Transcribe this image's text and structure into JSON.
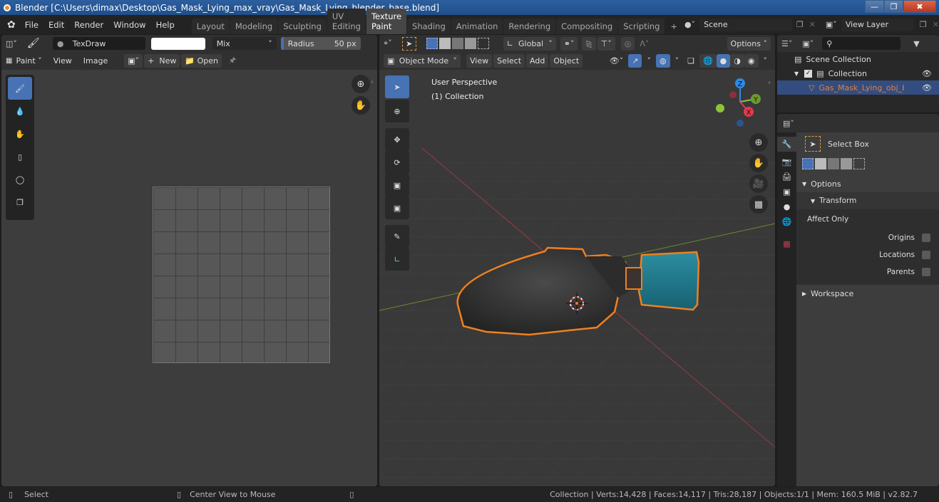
{
  "window": {
    "title": "Blender [C:\\Users\\dimax\\Desktop\\Gas_Mask_Lying_max_vray\\Gas_Mask_Lying_blender_base.blend]",
    "controls": [
      "minimize",
      "maximize",
      "close"
    ]
  },
  "menubar": {
    "items": [
      "File",
      "Edit",
      "Render",
      "Window",
      "Help"
    ],
    "workspace_tabs": [
      "Layout",
      "Modeling",
      "Sculpting",
      "UV Editing",
      "Texture Paint",
      "Shading",
      "Animation",
      "Rendering",
      "Compositing",
      "Scripting"
    ],
    "active_tab": "Texture Paint",
    "add_tab": "+",
    "scene": "Scene",
    "view_layer": "View Layer"
  },
  "image_editor": {
    "brush_name": "TexDraw",
    "color": "#ffffff",
    "blend_mode": "Mix",
    "radius_label": "Radius",
    "radius_value": "50 px",
    "mode_label": "Paint",
    "menus": [
      "View",
      "Image"
    ],
    "new_label": "New",
    "open_label": "Open",
    "tools": [
      "draw-brush",
      "soften-brush",
      "smear-brush",
      "clone-brush",
      "fill-brush",
      "mask-brush"
    ]
  },
  "viewport": {
    "transform_orientation": "Global",
    "options_label": "Options",
    "mode": "Object Mode",
    "menus": [
      "View",
      "Select",
      "Add",
      "Object"
    ],
    "overlay_text_1": "User Perspective",
    "overlay_text_2": "(1) Collection",
    "gizmo_axes": [
      "X",
      "Y",
      "Z"
    ],
    "tools": [
      "select-box",
      "cursor",
      "move",
      "rotate",
      "scale",
      "transform",
      "annotate",
      "measure"
    ],
    "nav_buttons": [
      "zoom",
      "pan",
      "camera",
      "perspective-toggle"
    ]
  },
  "outliner": {
    "search_placeholder": "",
    "items": [
      {
        "label": "Scene Collection",
        "level": 0
      },
      {
        "label": "Collection",
        "level": 1,
        "checked": true
      },
      {
        "label": "Gas_Mask_Lying_obj_bas",
        "level": 2,
        "selected": true
      }
    ]
  },
  "properties": {
    "tool_name": "Select Box",
    "options_label": "Options",
    "transform_label": "Transform",
    "affect_only_label": "Affect Only",
    "checkboxes": [
      {
        "label": "Origins",
        "checked": false
      },
      {
        "label": "Locations",
        "checked": false
      },
      {
        "label": "Parents",
        "checked": false
      }
    ],
    "workspace_label": "Workspace"
  },
  "statusbar": {
    "left_action": "Select",
    "middle_action": "Center View to Mouse",
    "stats": "Collection | Verts:14,428 | Faces:14,117 | Tris:28,187 | Objects:1/1 | Mem: 160.5 MiB | v2.82.7"
  },
  "colors": {
    "accent": "#4772b3",
    "selection_orange": "#f0801e",
    "object_teal": "#1f7a8c",
    "axis_x": "#e8384f",
    "axis_y": "#8bc43a",
    "axis_z": "#2f8ae8"
  }
}
